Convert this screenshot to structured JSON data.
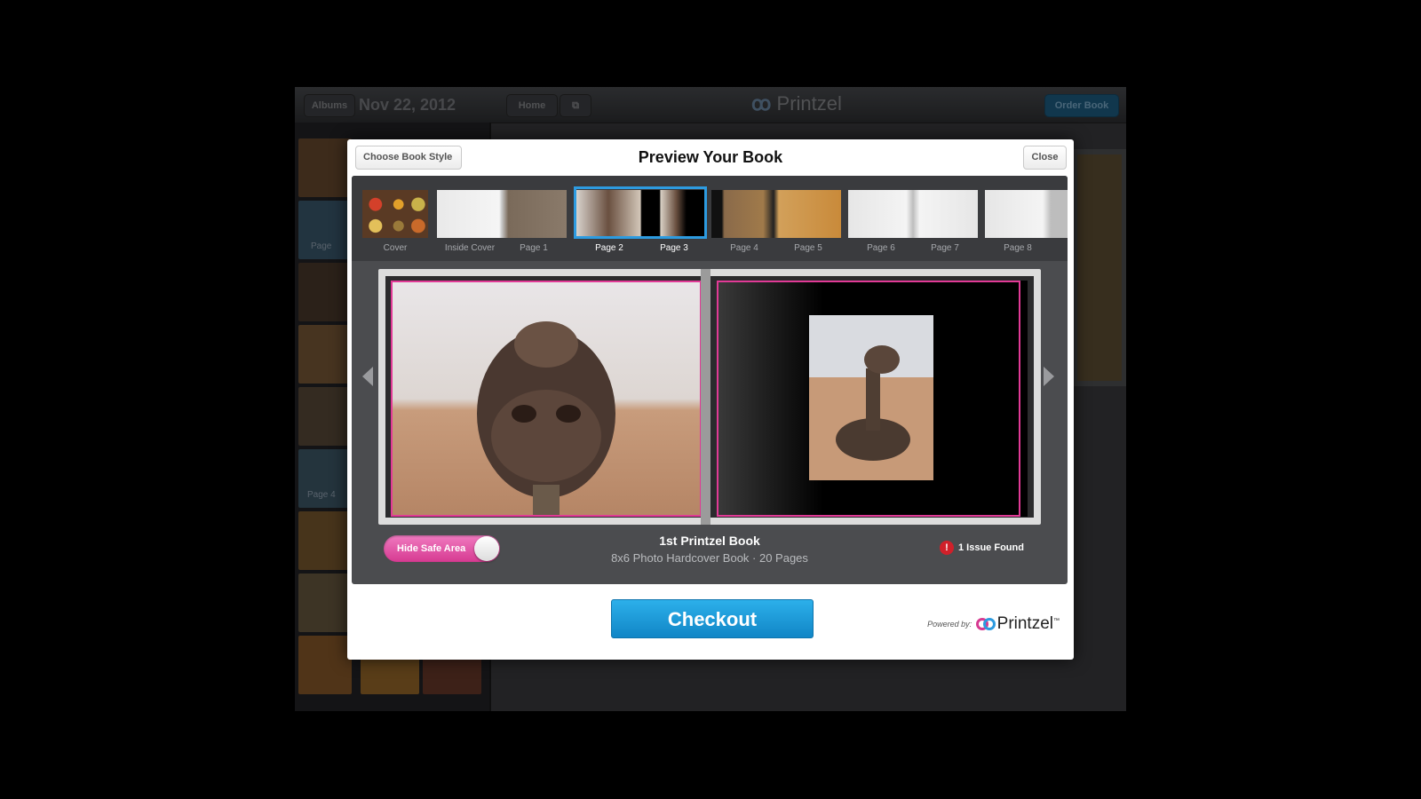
{
  "app": {
    "albums_label": "Albums",
    "date_title": "Nov 22, 2012",
    "home_label": "Home",
    "brand": "Printzel",
    "order_label": "Order Book",
    "sidebar_page_labels": [
      "Page",
      "Page 4"
    ]
  },
  "modal": {
    "back_label": "Choose Book Style",
    "title": "Preview Your Book",
    "close_label": "Close",
    "pages": [
      {
        "label": "Cover",
        "selected": false
      },
      {
        "label": "Inside Cover",
        "selected": false
      },
      {
        "label": "Page 1",
        "selected": false
      },
      {
        "label": "Page 2",
        "selected": true
      },
      {
        "label": "Page 3",
        "selected": true
      },
      {
        "label": "Page 4",
        "selected": false
      },
      {
        "label": "Page 5",
        "selected": false
      },
      {
        "label": "Page 6",
        "selected": false
      },
      {
        "label": "Page 7",
        "selected": false
      },
      {
        "label": "Page 8",
        "selected": false
      }
    ],
    "toggle_label": "Hide Safe Area",
    "toggle_on": true,
    "book_name": "1st Printzel Book",
    "book_meta": "8x6 Photo Hardcover Book  ·  20 Pages",
    "issue_icon": "!",
    "issue_text": "1 Issue Found",
    "checkout_label": "Checkout",
    "powered_by": "Powered by:",
    "powered_brand": "Printzel",
    "trademark": "™"
  },
  "colors": {
    "accent": "#2d9be0",
    "safe_area": "#e13a96",
    "checkout": "#1a9ad8",
    "issue": "#d0202a"
  }
}
